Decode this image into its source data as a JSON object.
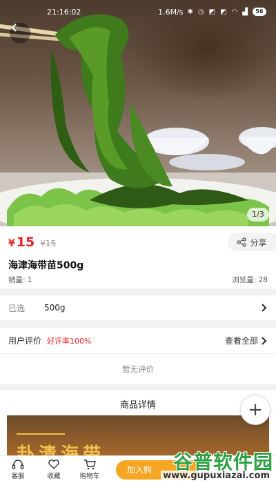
{
  "status_bar": {
    "time": "21:16:02",
    "speed": "1.6M/s",
    "icons": [
      "bluetooth-icon",
      "alarm-icon",
      "sim-icon",
      "sim-icon",
      "wifi-icon",
      "signal-icon"
    ],
    "battery": "56"
  },
  "gallery": {
    "indicator": "1/3"
  },
  "product": {
    "currency": "¥",
    "price": "15",
    "original_currency": "¥",
    "original_price": "15",
    "share_label": "分享",
    "title": "海津海带苗500g",
    "sales": "销量: 1",
    "views": "浏览量: 28"
  },
  "spec": {
    "label": "已选",
    "value": "500g"
  },
  "reviews": {
    "title": "用户评价",
    "rate": "好评率100%",
    "view_all": "查看全部",
    "empty": "暂无评价"
  },
  "detail": {
    "title": "商品详情",
    "image_text": "卦清海带"
  },
  "bottom_bar": {
    "service": "客服",
    "favorite": "收藏",
    "cart": "购物车",
    "add_to_cart": "加入购"
  },
  "watermark": {
    "cn": "谷普软件园",
    "url": "www.gupuxiazai.com"
  },
  "colors": {
    "price_red": "#e8262d",
    "cart_orange": "#f5a623",
    "watermark_green": "#2ea143"
  }
}
